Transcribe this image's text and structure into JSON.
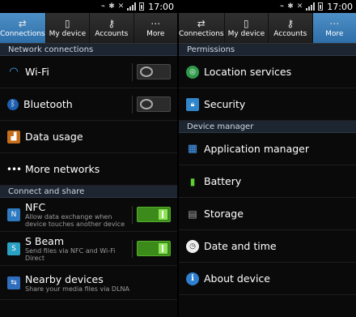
{
  "status": {
    "time": "17:00"
  },
  "colors": {
    "tab_active": "#3a7fbf",
    "section_bg": "#1c2530",
    "toggle_on": "#4caf23"
  },
  "tabs": [
    {
      "label": "Connections",
      "icon": "connections-icon"
    },
    {
      "label": "My device",
      "icon": "phone-icon"
    },
    {
      "label": "Accounts",
      "icon": "key-icon"
    },
    {
      "label": "More",
      "icon": "more-dots-icon"
    }
  ],
  "left": {
    "active_tab": 0,
    "sections": [
      {
        "header": "Network connections",
        "items": [
          {
            "label": "Wi-Fi",
            "icon": "wifi-icon",
            "toggle": "off"
          },
          {
            "label": "Bluetooth",
            "icon": "bluetooth-icon",
            "toggle": "off"
          },
          {
            "label": "Data usage",
            "icon": "data-usage-icon"
          },
          {
            "label": "More networks",
            "icon": "more-networks-icon"
          }
        ]
      },
      {
        "header": "Connect and share",
        "items": [
          {
            "label": "NFC",
            "sub": "Allow data exchange when device touches another device",
            "icon": "nfc-icon",
            "toggle": "on"
          },
          {
            "label": "S Beam",
            "sub": "Send files via NFC and Wi-Fi Direct",
            "icon": "sbeam-icon",
            "toggle": "on"
          },
          {
            "label": "Nearby devices",
            "sub": "Share your media files via DLNA",
            "icon": "nearby-devices-icon"
          }
        ]
      }
    ]
  },
  "right": {
    "active_tab": 3,
    "sections": [
      {
        "header": "Permissions",
        "items": [
          {
            "label": "Location services",
            "icon": "location-icon"
          },
          {
            "label": "Security",
            "icon": "lock-icon"
          }
        ]
      },
      {
        "header": "Device manager",
        "items": [
          {
            "label": "Application manager",
            "icon": "app-grid-icon"
          },
          {
            "label": "Battery",
            "icon": "battery-icon"
          },
          {
            "label": "Storage",
            "icon": "storage-icon"
          },
          {
            "label": "Date and time",
            "icon": "clock-icon"
          },
          {
            "label": "About device",
            "icon": "info-icon"
          }
        ]
      }
    ]
  }
}
